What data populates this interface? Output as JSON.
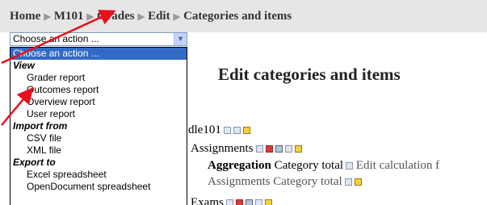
{
  "breadcrumb": {
    "items": [
      "Home",
      "M101",
      "Grades",
      "Edit",
      "Categories and items"
    ]
  },
  "action_select": {
    "value": "Choose an action ..."
  },
  "dropdown": {
    "rows": [
      {
        "label": "Choose an action ...",
        "kind": "selected"
      },
      {
        "label": "View",
        "kind": "group"
      },
      {
        "label": "Grader report",
        "kind": "option"
      },
      {
        "label": "Outcomes report",
        "kind": "option"
      },
      {
        "label": "Overview report",
        "kind": "option"
      },
      {
        "label": "User report",
        "kind": "option"
      },
      {
        "label": "Import from",
        "kind": "group"
      },
      {
        "label": "CSV file",
        "kind": "option"
      },
      {
        "label": "XML file",
        "kind": "option"
      },
      {
        "label": "Export to",
        "kind": "group"
      },
      {
        "label": "Excel spreadsheet",
        "kind": "option"
      },
      {
        "label": "OpenDocument spreadsheet",
        "kind": "option"
      }
    ]
  },
  "page": {
    "heading": "Edit categories and items"
  },
  "tree": {
    "course_fragment": "dle101",
    "assignments_label": "Assignments",
    "aggregation_label": "Aggregation",
    "category_total": "Category total",
    "edit_calculation": "Edit calculation f",
    "assignments_category_total": "Assignments Category total",
    "exams_fragment": "Exams"
  },
  "colors": {
    "annotation_arrow": "#e8101a",
    "selected_row": "#316ac5"
  }
}
